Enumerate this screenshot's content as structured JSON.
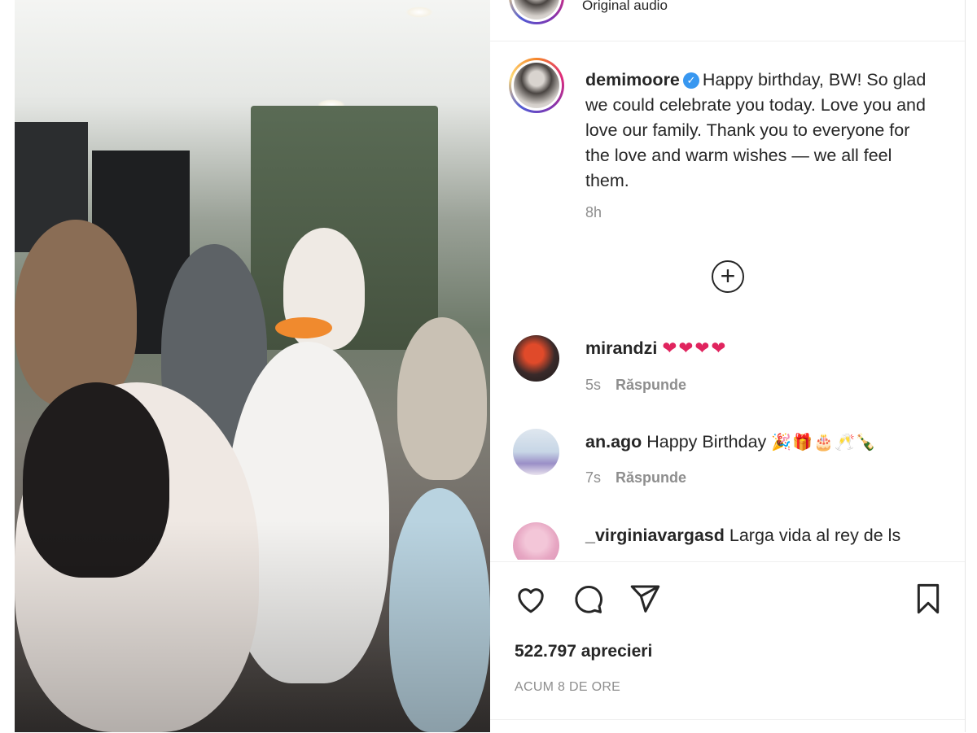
{
  "post": {
    "audio_label": "Original audio",
    "caption": {
      "username": "demimoore",
      "verified": true,
      "text": "Happy birthday, BW! So glad we could celebrate you today. Love you and love our family. Thank you to everyone for the love and warm wishes — we all feel them.",
      "time": "8h"
    },
    "load_more_icon": "plus-circle-icon",
    "comments": [
      {
        "username": "mirandzi",
        "text": "❤❤❤❤",
        "time": "5s",
        "reply": "Răspunde"
      },
      {
        "username": "an.ago",
        "text": "Happy Birthday",
        "emoji": "🎉🎁🎂🥂🍾",
        "time": "7s",
        "reply": "Răspunde"
      },
      {
        "username": "_virginiavargasd",
        "text": "Larga vida al rey de ls",
        "time": "",
        "reply": ""
      }
    ],
    "actions": {
      "like_icon": "heart-icon",
      "comment_icon": "comment-icon",
      "share_icon": "share-icon",
      "save_icon": "bookmark-icon"
    },
    "likes": "522.797 aprecieri",
    "posted": "ACUM 8 DE ORE"
  },
  "colors": {
    "text": "#262626",
    "muted": "#8e8e8e",
    "verified": "#3897f0",
    "heart": "#e0245e"
  }
}
